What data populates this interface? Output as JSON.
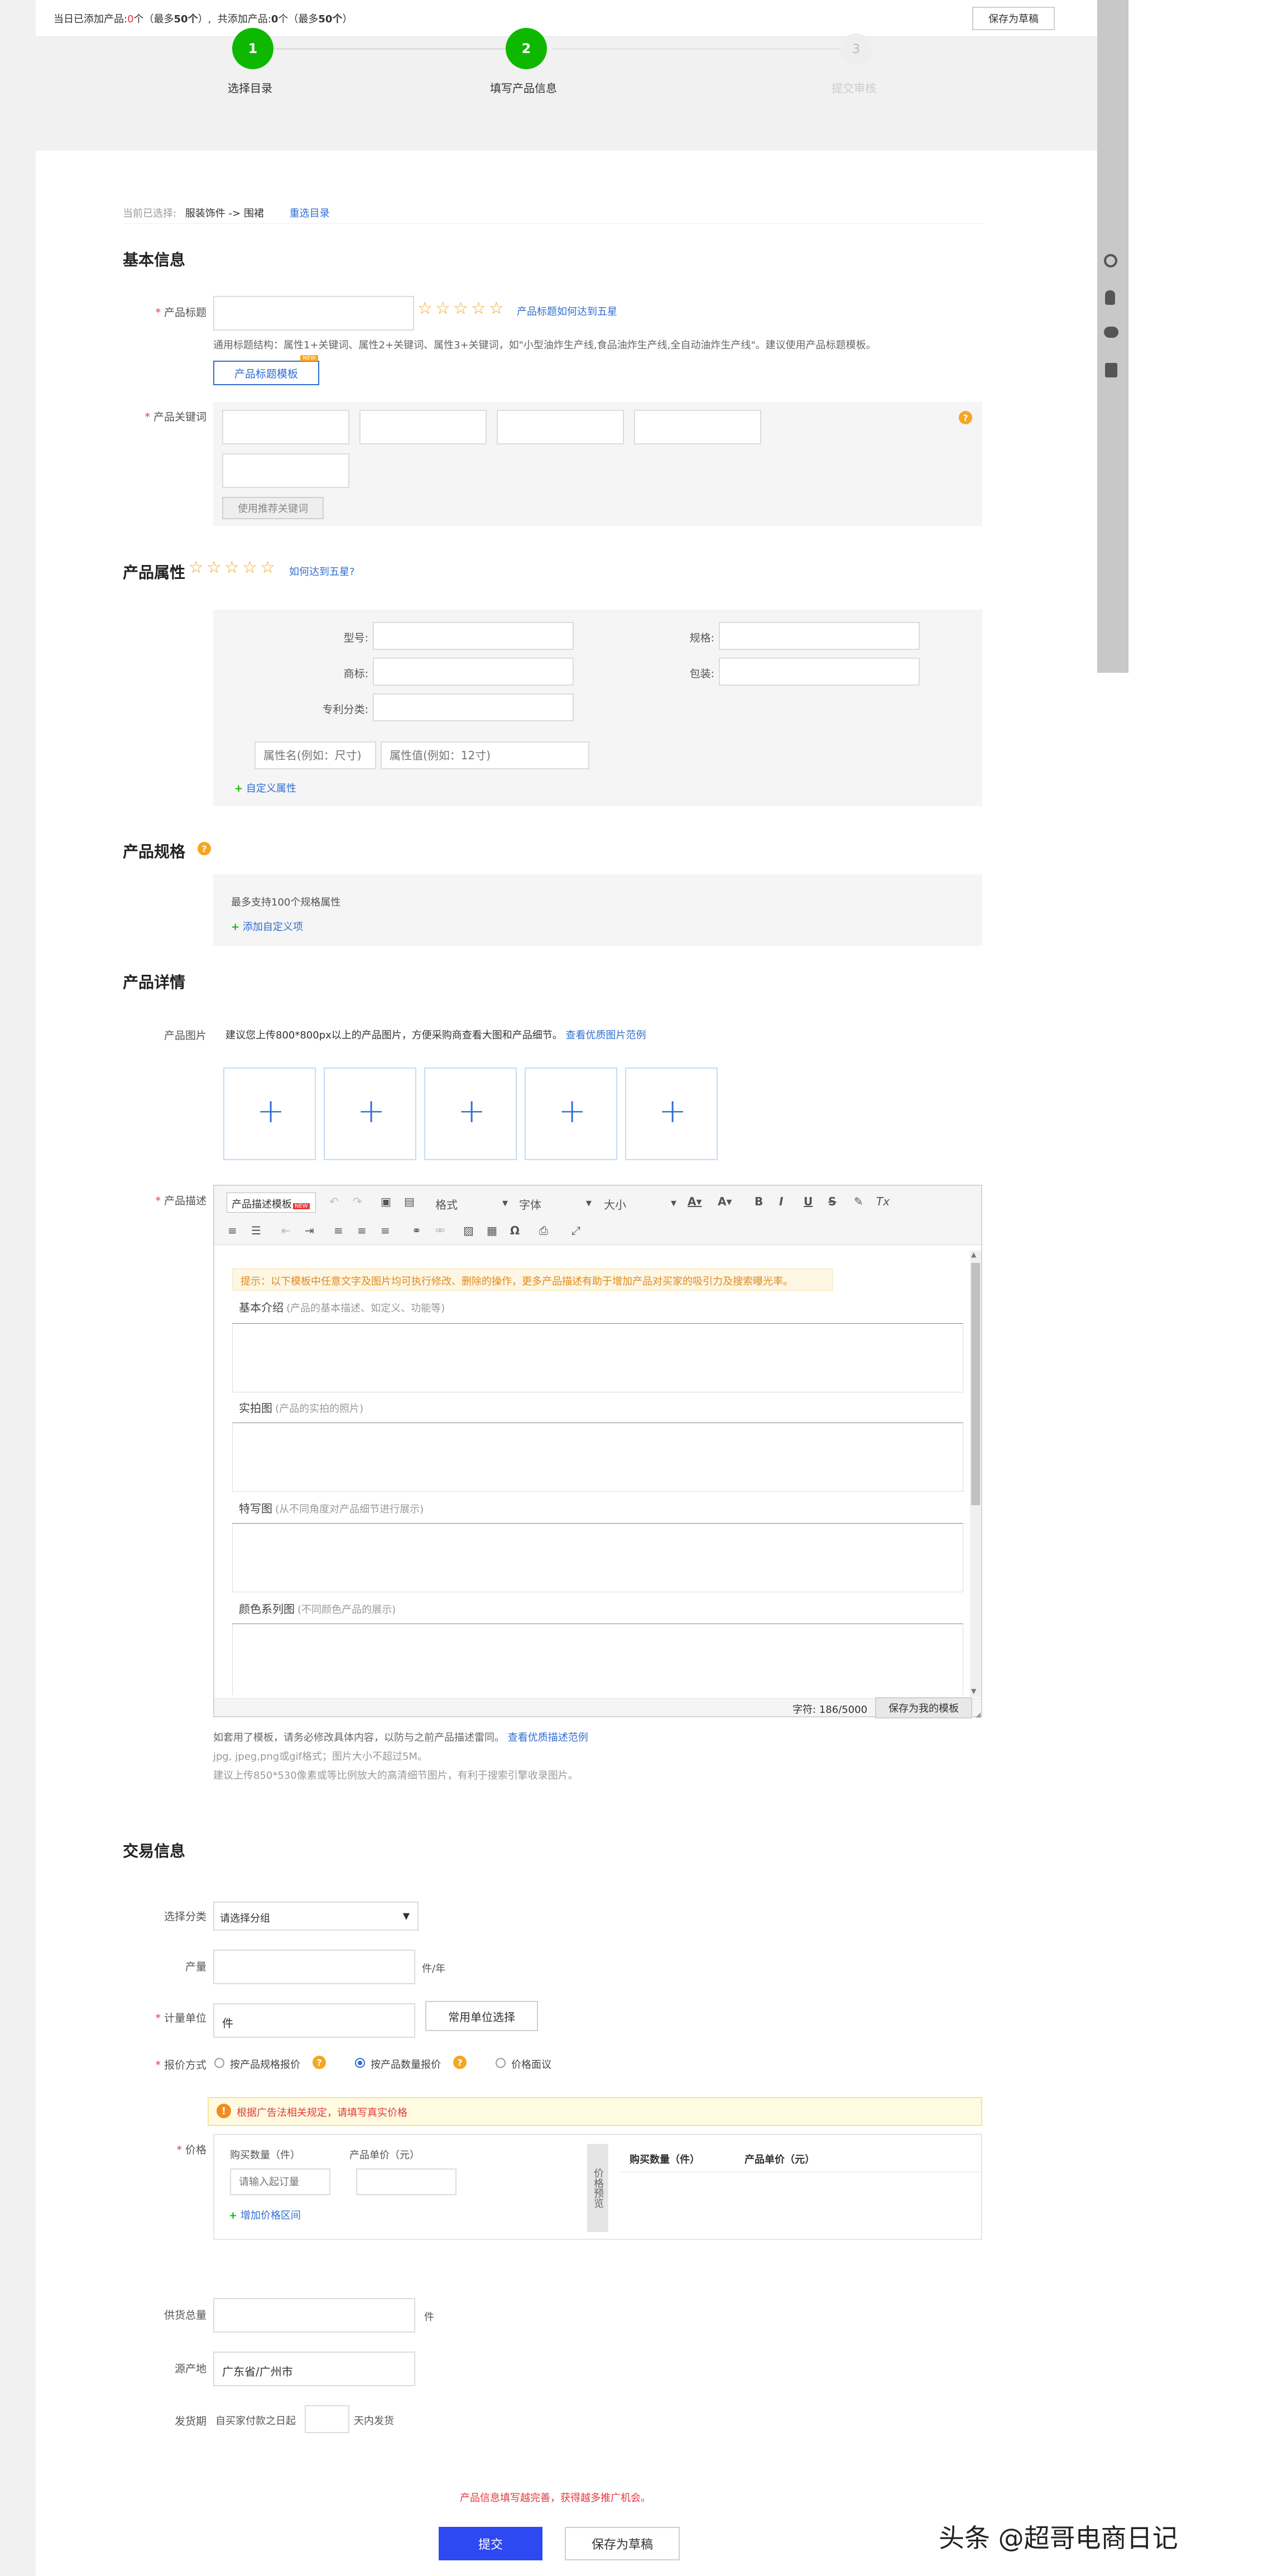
{
  "topbar": {
    "prefix": "当日已添加产品:",
    "today_count": "0",
    "unit1": "个",
    "max1_open": "（最多",
    "max1": "50个",
    "max1_close": "）,",
    "total_label": "共添加产品:",
    "total_count": "0",
    "unit2": "个",
    "max2_open": "（最多",
    "max2": "50个",
    "max2_close": "）",
    "save_draft": "保存为草稿"
  },
  "steps": [
    {
      "num": "1",
      "label": "选择目录"
    },
    {
      "num": "2",
      "label": "填写产品信息"
    },
    {
      "num": "3",
      "label": "提交审核"
    }
  ],
  "breadcrumb": {
    "prefix": "当前已选择:",
    "path": "服装饰件 -> 围裙",
    "reselect": "重选目录"
  },
  "basic": {
    "title": "基本信息",
    "title_label": "产品标题",
    "title_hint": "产品标题如何达到五星",
    "title_desc": "通用标题结构：属性1+关键词、属性2+关键词、属性3+关键词，如\"小型油炸生产线,食品油炸生产线,全自动油炸生产线\"。建议使用产品标题模板。",
    "template_btn": "产品标题模板",
    "new_badge": "NEW",
    "keyword_label": "产品关键词",
    "keyword_btn": "使用推荐关键词",
    "help": "?"
  },
  "attrs": {
    "title": "产品属性",
    "hint": "如何达到五星?",
    "model": "型号:",
    "spec": "规格:",
    "brand": "商标:",
    "pack": "包装:",
    "patent": "专利分类:",
    "attr_name_ph": "属性名(例如：尺寸)",
    "attr_val_ph": "属性值(例如：12寸)",
    "custom": "自定义属性"
  },
  "spec": {
    "title": "产品规格",
    "help": "?",
    "max": "最多支持100个规格属性",
    "add": "添加自定义项"
  },
  "detail": {
    "title": "产品详情",
    "pic_label": "产品图片",
    "pic_hint": "建议您上传800*800px以上的产品图片，方便采购商查看大图和产品细节。",
    "pic_example": "查看优质图片范例",
    "desc_label": "产品描述",
    "toolbar": {
      "template": "产品描述模板",
      "new": "NEW",
      "format": "格式",
      "font": "字体",
      "size": "大小",
      "bold": "B",
      "italic": "I",
      "underline": "U",
      "strike": "S",
      "clear": "Tx"
    },
    "tip": "提示：以下模板中任意文字及图片均可执行修改、删除的操作，更多产品描述有助于增加产品对买家的吸引力及搜索曝光率。",
    "sections": [
      {
        "title": "基本介绍",
        "sub": "(产品的基本描述、如定义、功能等)"
      },
      {
        "title": "实拍图",
        "sub": "(产品的实拍的照片)"
      },
      {
        "title": "特写图",
        "sub": "(从不同角度对产品细节进行展示)"
      },
      {
        "title": "颜色系列图",
        "sub": "(不同颜色产品的展示)"
      }
    ],
    "char_count": "字符: 186/5000",
    "save_tpl": "保存为我的模板",
    "note1": "如套用了模板，请务必修改具体内容，以防与之前产品描述雷同。",
    "note1_link": "查看优质描述范例",
    "note2": "jpg, jpeg,png或gif格式；图片大小不超过5M。",
    "note3": "建议上传850*530像素或等比例放大的高清细节图片，有利于搜索引擎收录图片。"
  },
  "trade": {
    "title": "交易信息",
    "category_label": "选择分类",
    "category_value": "请选择分组",
    "output_label": "产量",
    "output_unit": "件/年",
    "unit_label": "计量单位",
    "unit_value": "件",
    "unit_btn": "常用单位选择",
    "quote_label": "报价方式",
    "quote_opt1": "按产品规格报价",
    "quote_opt2": "按产品数量报价",
    "quote_opt3": "价格面议",
    "warn": "根据广告法相关规定，请填写真实价格",
    "price_label": "价格",
    "buy_qty": "购买数量（件）",
    "unit_price": "产品单价（元）",
    "min_order_ph": "请输入起订量",
    "add_range": "增加价格区间",
    "preview_label": "价格预览",
    "preview_qty": "购买数量（件）",
    "preview_price": "产品单价（元）",
    "supply_label": "供货总量",
    "supply_unit": "件",
    "origin_label": "源产地",
    "origin_value": "广东省/广州市",
    "ship_label": "发货期",
    "ship_prefix": "自买家付款之日起",
    "ship_suffix": "天内发货"
  },
  "footer": {
    "notice": "产品信息填写越完善，获得越多推广机会。",
    "submit": "提交",
    "save_draft": "保存为草稿"
  },
  "watermark": "头条 @超哥电商日记"
}
